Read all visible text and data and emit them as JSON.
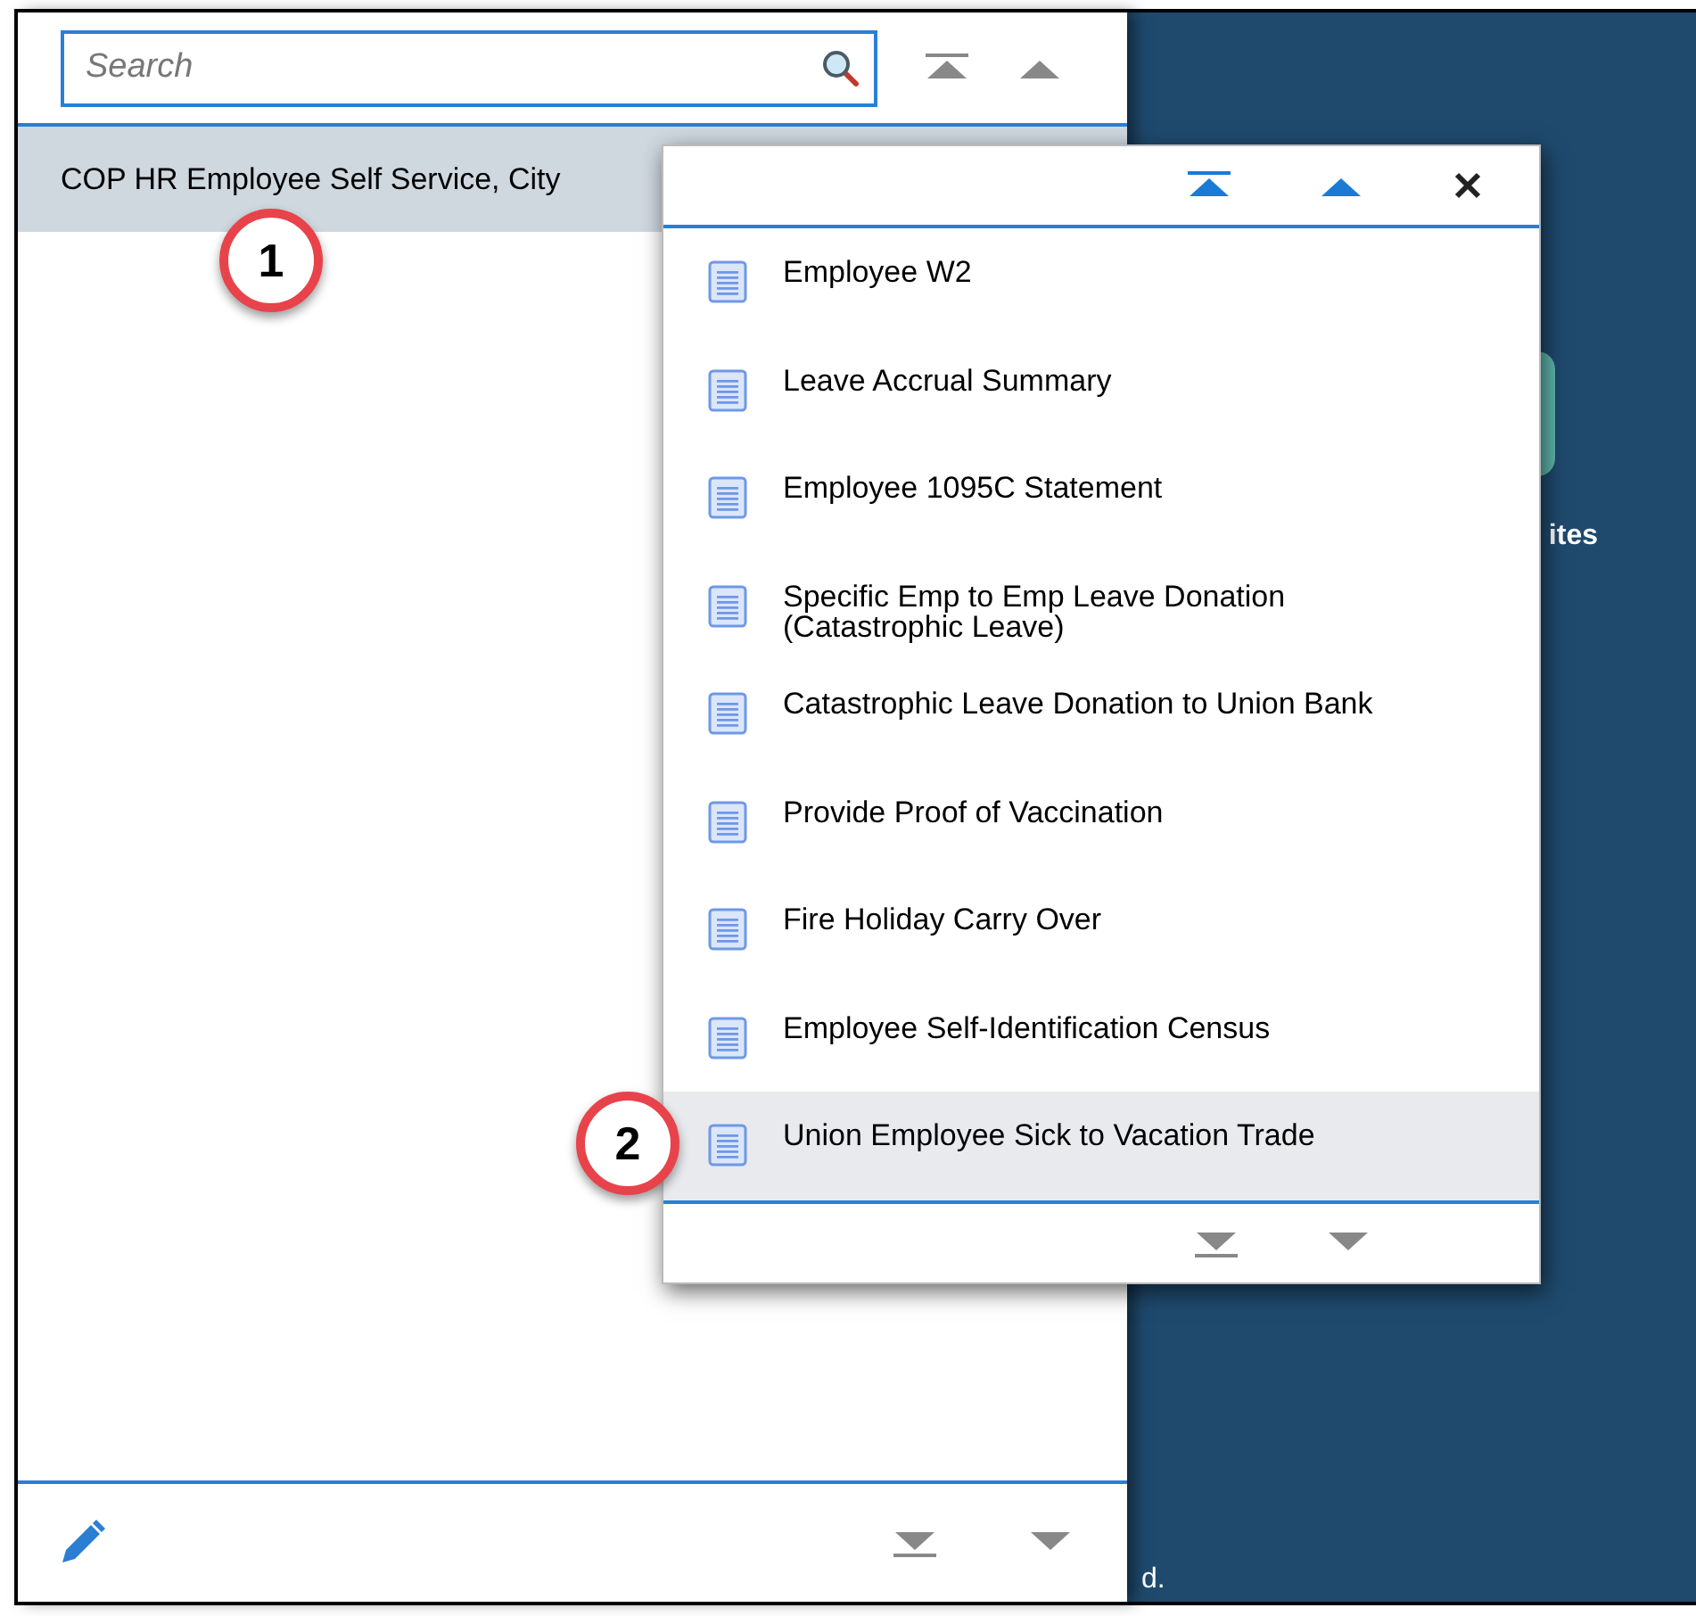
{
  "search": {
    "placeholder": "Search"
  },
  "left_list": [
    {
      "label": "COP HR Employee Self Service, City",
      "selected": true
    }
  ],
  "background_tile": {
    "label": "ites"
  },
  "background_footer": "d.",
  "popup": {
    "items": [
      {
        "label": "Employee W2",
        "selected": false
      },
      {
        "label": "Leave Accrual Summary",
        "selected": false
      },
      {
        "label": "Employee 1095C Statement",
        "selected": false
      },
      {
        "label": "Specific Emp to Emp Leave Donation (Catastrophic Leave)",
        "selected": false
      },
      {
        "label": "Catastrophic Leave Donation to Union Bank",
        "selected": false
      },
      {
        "label": "Provide Proof of Vaccination",
        "selected": false
      },
      {
        "label": "Fire Holiday Carry Over",
        "selected": false
      },
      {
        "label": "Employee Self-Identification Census",
        "selected": false
      },
      {
        "label": "Union Employee Sick to Vacation Trade",
        "selected": true
      }
    ]
  },
  "callouts": [
    "1",
    "2"
  ]
}
